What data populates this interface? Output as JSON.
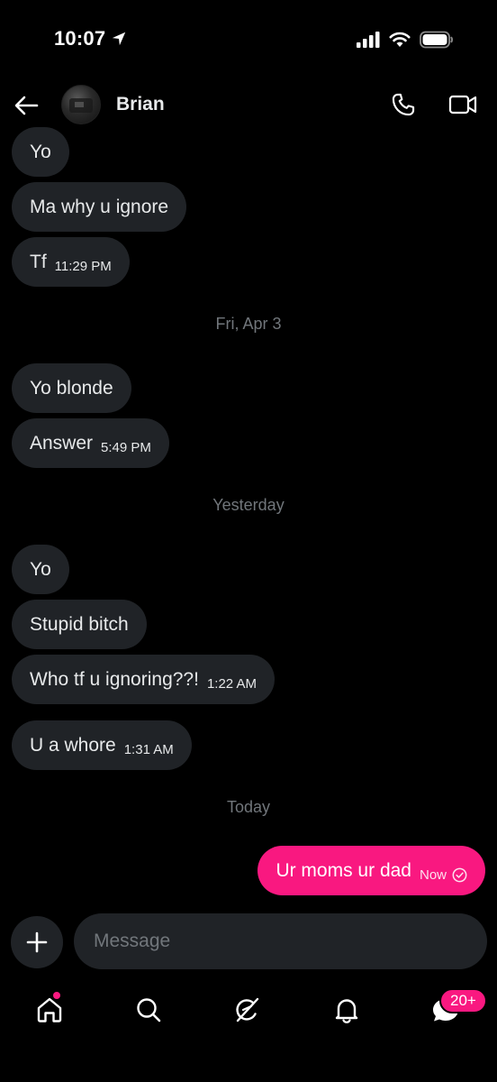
{
  "status_bar": {
    "time": "10:07"
  },
  "header": {
    "contact_name": "Brian"
  },
  "messages": [
    {
      "text": "Yo",
      "time": ""
    },
    {
      "text": "Ma why u ignore",
      "time": ""
    },
    {
      "text": "Tf",
      "time": "11:29 PM"
    },
    {
      "text": "Yo blonde",
      "time": ""
    },
    {
      "text": "Answer",
      "time": "5:49 PM"
    },
    {
      "text": "Yo",
      "time": ""
    },
    {
      "text": "Stupid bitch",
      "time": ""
    },
    {
      "text": "Who tf u ignoring??!",
      "time": "1:22 AM"
    },
    {
      "text": "U a whore",
      "time": "1:31 AM"
    }
  ],
  "sent_message": {
    "text": "Ur moms ur dad",
    "time": "Now"
  },
  "date_separators": [
    "Fri, Apr 3",
    "Yesterday",
    "Today"
  ],
  "composer": {
    "placeholder": "Message"
  },
  "bottom_nav": {
    "items": [
      "home-icon",
      "search-icon",
      "grok-icon",
      "notifications-icon",
      "messages-icon"
    ],
    "messages_badge": "20+"
  },
  "colors": {
    "accent": "#f91880",
    "bubble": "#202327",
    "muted": "#71767b",
    "background": "#000000"
  }
}
